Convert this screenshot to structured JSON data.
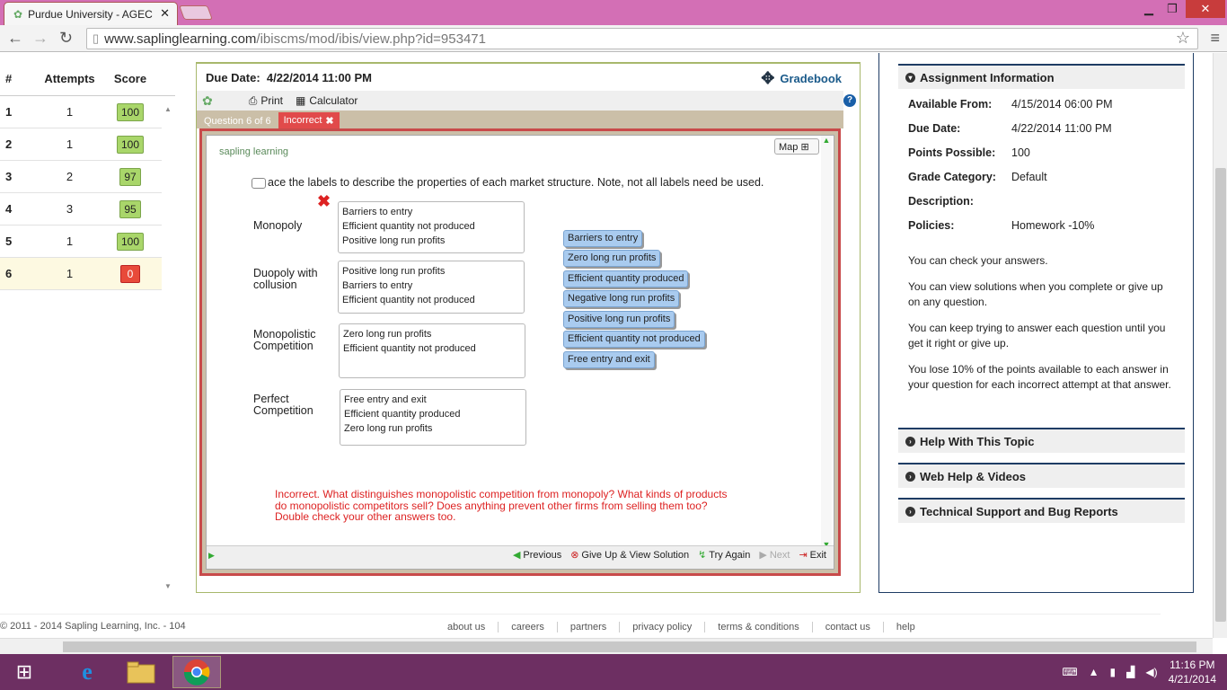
{
  "browser": {
    "tab_title": "Purdue University - AGEC",
    "url_host": "www.saplinglearning.com",
    "url_path": "/ibiscms/mod/ibis/view.php?id=953471"
  },
  "score_table": {
    "headers": [
      "#",
      "Attempts",
      "Score"
    ],
    "rows": [
      {
        "num": "1",
        "attempts": "1",
        "score": "100"
      },
      {
        "num": "2",
        "attempts": "1",
        "score": "100"
      },
      {
        "num": "3",
        "attempts": "2",
        "score": "97"
      },
      {
        "num": "4",
        "attempts": "3",
        "score": "95"
      },
      {
        "num": "5",
        "attempts": "1",
        "score": "100"
      },
      {
        "num": "6",
        "attempts": "1",
        "score": "0"
      }
    ]
  },
  "assignment": {
    "due_label": "Due Date:",
    "due_value": "4/22/2014 11:00 PM",
    "gradebook": "Gradebook",
    "print": "Print",
    "calculator": "Calculator",
    "question_label": "Question 6 of 6",
    "status_tab": "Incorrect"
  },
  "question": {
    "logo": "sapling learning",
    "map": "Map",
    "instruction": "ace the labels to describe the properties of each market structure. Note, not all labels need be used.",
    "rows": [
      {
        "label": "Monopoly",
        "items": [
          "Barriers to entry",
          "Efficient quantity not produced",
          "Positive long run profits"
        ]
      },
      {
        "label": "Duopoly with collusion",
        "items": [
          "Positive long run profits",
          "Barriers to entry",
          "Efficient quantity not produced"
        ]
      },
      {
        "label": "Monopolistic Competition",
        "items": [
          "Zero long run profits",
          "Efficient quantity not produced"
        ]
      },
      {
        "label": "Perfect Competition",
        "items": [
          "Free entry and exit",
          "Efficient quantity produced",
          "Zero long run profits"
        ]
      }
    ],
    "label_bank": [
      "Barriers to entry",
      "Zero long run profits",
      "Efficient quantity produced",
      "Negative long run profits",
      "Positive long run profits",
      "Efficient quantity not produced",
      "Free entry and exit"
    ],
    "feedback": "Incorrect. What distinguishes monopolistic competition from monopoly? What kinds of products do monopolistic competitors sell? Does anything prevent other firms from selling them too? Double check your other answers too.",
    "nav": {
      "previous": "Previous",
      "give_up": "Give Up & View Solution",
      "try_again": "Try Again",
      "next": "Next",
      "exit": "Exit"
    }
  },
  "info_panel": {
    "title": "Assignment Information",
    "fields": [
      {
        "label": "Available From:",
        "value": "4/15/2014 06:00 PM"
      },
      {
        "label": "Due Date:",
        "value": "4/22/2014 11:00 PM"
      },
      {
        "label": "Points Possible:",
        "value": "100"
      },
      {
        "label": "Grade Category:",
        "value": "Default"
      },
      {
        "label": "Description:",
        "value": ""
      },
      {
        "label": "Policies:",
        "value": "Homework -10%"
      }
    ],
    "notes": [
      "You can check your answers.",
      "You can view solutions when you complete or give up on any question.",
      "You can keep trying to answer each question until you get it right or give up.",
      "You lose 10% of the points available to each answer in your question for each incorrect attempt at that answer."
    ],
    "sections": [
      "Help With This Topic",
      "Web Help & Videos",
      "Technical Support and Bug Reports"
    ]
  },
  "footer": {
    "copyright": "© 2011 - 2014 Sapling Learning, Inc. - 104",
    "links": [
      "about us",
      "careers",
      "partners",
      "privacy policy",
      "terms & conditions",
      "contact us",
      "help"
    ]
  },
  "taskbar": {
    "time": "11:16 PM",
    "date": "4/21/2014"
  },
  "colors": {
    "titlebar": "#d36fb5",
    "score_green": "#a9d66a",
    "score_red": "#e84a3a",
    "taskbar": "#6d2f62",
    "incorrect": "#d22222"
  }
}
